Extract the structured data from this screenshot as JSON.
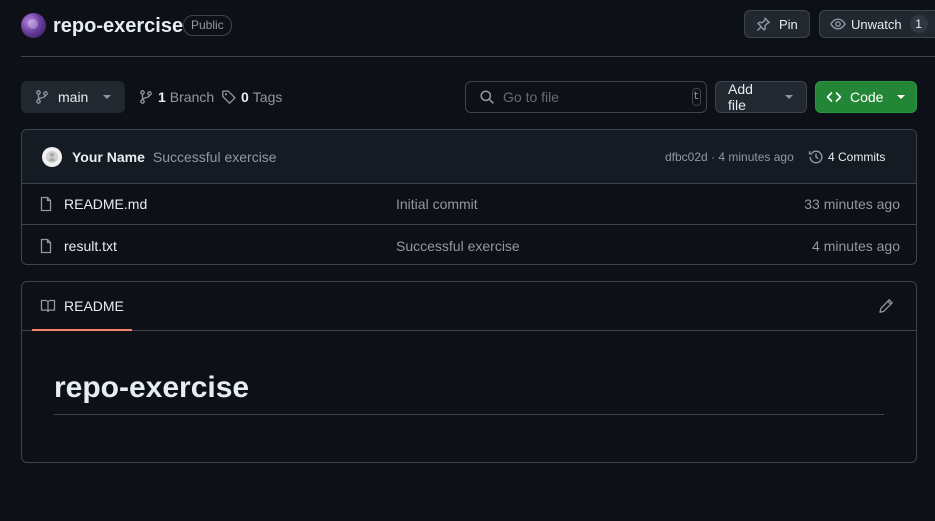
{
  "repo": {
    "name": "repo-exercise",
    "visibility": "Public"
  },
  "header_actions": {
    "pin_label": "Pin",
    "unwatch_label": "Unwatch",
    "watch_count": "1"
  },
  "toolbar": {
    "branch": "main",
    "branch_count": "1",
    "branch_label": "Branch",
    "tag_count": "0",
    "tag_label": "Tags",
    "search_placeholder": "Go to file",
    "search_shortcut": "t",
    "add_file_label": "Add file",
    "code_label": "Code"
  },
  "latest_commit": {
    "author": "Your Name",
    "message": "Successful exercise",
    "meta": "dfbc02d · 4 minutes ago",
    "commits_label": "4 Commits"
  },
  "files": [
    {
      "name": "README.md",
      "commit": "Initial commit",
      "time": "33 minutes ago"
    },
    {
      "name": "result.txt",
      "commit": "Successful exercise",
      "time": "4 minutes ago"
    }
  ],
  "readme": {
    "tab_label": "README",
    "title": "repo-exercise"
  },
  "colors": {
    "background": "#0d1117",
    "border": "#3d444d",
    "code_button": "#238636",
    "tab_underline": "#f78166"
  }
}
